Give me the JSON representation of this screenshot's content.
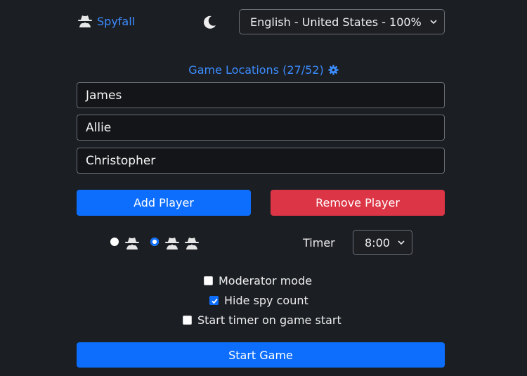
{
  "header": {
    "brand": "Spyfall",
    "language_selected": "English - United States - 100%"
  },
  "locations_link": "Game Locations (27/52)",
  "players": [
    "James",
    "Allie",
    "Christopher"
  ],
  "buttons": {
    "add_player": "Add Player",
    "remove_player": "Remove Player",
    "start_game": "Start Game"
  },
  "spy_count": {
    "options": [
      1,
      2
    ],
    "selected": 2
  },
  "timer": {
    "label": "Timer",
    "selected": "8:00"
  },
  "options": {
    "moderator_mode": {
      "label": "Moderator mode",
      "checked": false
    },
    "hide_spy_count": {
      "label": "Hide spy count",
      "checked": true
    },
    "start_timer": {
      "label": "Start timer on game start",
      "checked": false
    }
  },
  "colors": {
    "primary": "#0d6efd",
    "danger": "#dc3545",
    "link": "#3c8dff",
    "background": "#1b1e23"
  }
}
